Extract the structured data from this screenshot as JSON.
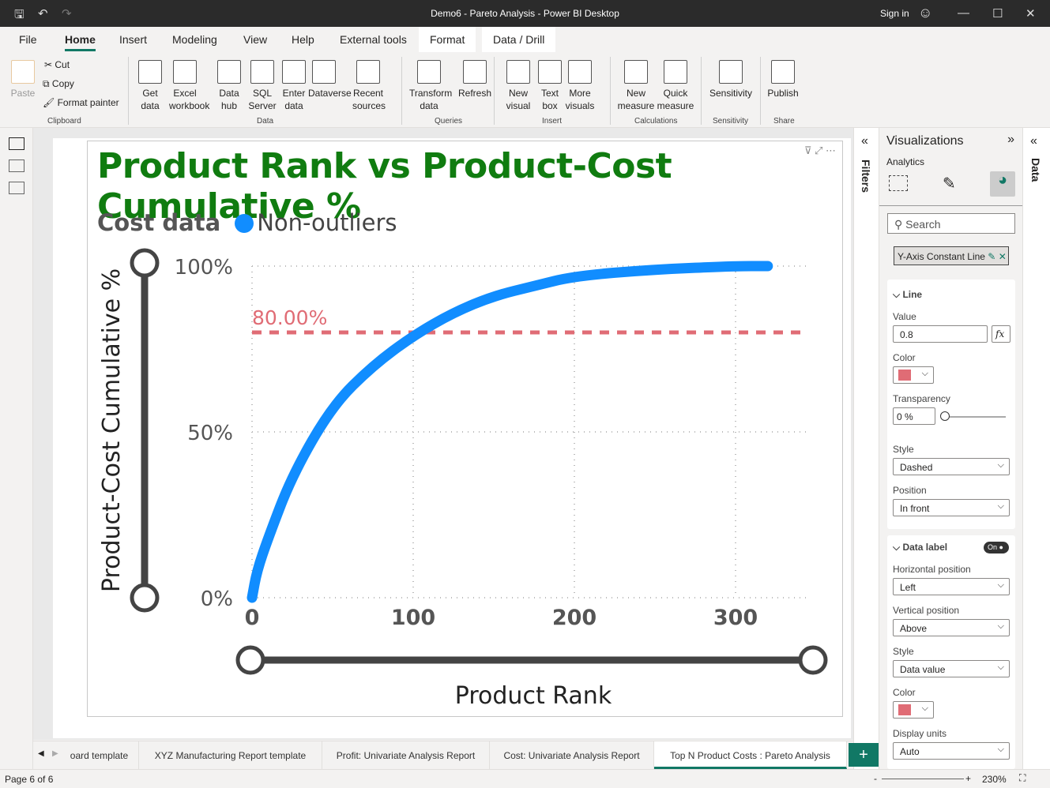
{
  "window": {
    "title": "Demo6 - Pareto Analysis - Power BI Desktop",
    "sign_in": "Sign in"
  },
  "menu": [
    "File",
    "Home",
    "Insert",
    "Modeling",
    "View",
    "Help",
    "External tools",
    "Format",
    "Data / Drill"
  ],
  "ribbon": {
    "clipboard": {
      "paste": "Paste",
      "cut": "Cut",
      "copy": "Copy",
      "format_painter": "Format painter",
      "group": "Clipboard"
    },
    "data": {
      "items": [
        "Get data",
        "Excel workbook",
        "Data hub",
        "SQL Server",
        "Enter data",
        "Dataverse",
        "Recent sources"
      ],
      "group": "Data"
    },
    "queries": {
      "items": [
        "Transform data",
        "Refresh"
      ],
      "group": "Queries"
    },
    "insert": {
      "items": [
        "New visual",
        "Text box",
        "More visuals"
      ],
      "group": "Insert"
    },
    "calculations": {
      "items": [
        "New measure",
        "Quick measure"
      ],
      "group": "Calculations"
    },
    "sensitivity": {
      "items": [
        "Sensitivity"
      ],
      "group": "Sensitivity"
    },
    "share": {
      "items": [
        "Publish"
      ],
      "group": "Share"
    }
  },
  "visual": {
    "title": "Product Rank vs Product-Cost Cumulative %",
    "legend_title": "Cost data",
    "legend_item": "Non-outliers"
  },
  "chart_data": {
    "type": "line",
    "xlabel": "Product Rank",
    "ylabel": "Product-Cost Cumulative %",
    "xlim": [
      0,
      345
    ],
    "ylim": [
      0,
      100
    ],
    "x_ticks": [
      "0",
      "100",
      "200",
      "300"
    ],
    "y_ticks": [
      "0%",
      "50%",
      "100%"
    ],
    "grid": true,
    "legend": "top-left",
    "series": [
      {
        "name": "Non-outliers",
        "color": "#118dff",
        "x": [
          0,
          3,
          10,
          25,
          50,
          75,
          100,
          125,
          150,
          175,
          200,
          250,
          300,
          320
        ],
        "y": [
          0,
          8,
          18,
          37,
          58,
          70,
          79,
          86,
          91,
          94,
          97,
          99,
          100,
          100
        ]
      }
    ],
    "reference_line": {
      "value": 0.8,
      "label": "80.00%",
      "color": "#e06c75",
      "style": "dashed"
    }
  },
  "filters_label": "Filters",
  "data_label": "Data",
  "viz": {
    "title": "Visualizations",
    "subtitle": "Analytics",
    "search_placeholder": "Search",
    "chip": "Y-Axis Constant Line",
    "line": {
      "header": "Line",
      "value_label": "Value",
      "value": "0.8",
      "fx": "fx",
      "color_label": "Color",
      "transparency_label": "Transparency",
      "transparency": "0 %",
      "transparency_pct": 0,
      "style_label": "Style",
      "style": "Dashed",
      "position_label": "Position",
      "position": "In front"
    },
    "datalabel": {
      "header": "Data label",
      "toggle": "On",
      "hpos_label": "Horizontal position",
      "hpos": "Left",
      "vpos_label": "Vertical position",
      "vpos": "Above",
      "style_label": "Style",
      "style": "Data value",
      "color_label": "Color",
      "units_label": "Display units",
      "units": "Auto"
    },
    "accent": "#e06c75"
  },
  "tabs": [
    "oard template",
    "XYZ Manufacturing Report template",
    "Profit: Univariate Analysis Report",
    "Cost: Univariate Analysis Report",
    "Top N Product Costs : Pareto Analysis"
  ],
  "status": {
    "page": "Page 6 of 6",
    "zoom": "230%"
  }
}
